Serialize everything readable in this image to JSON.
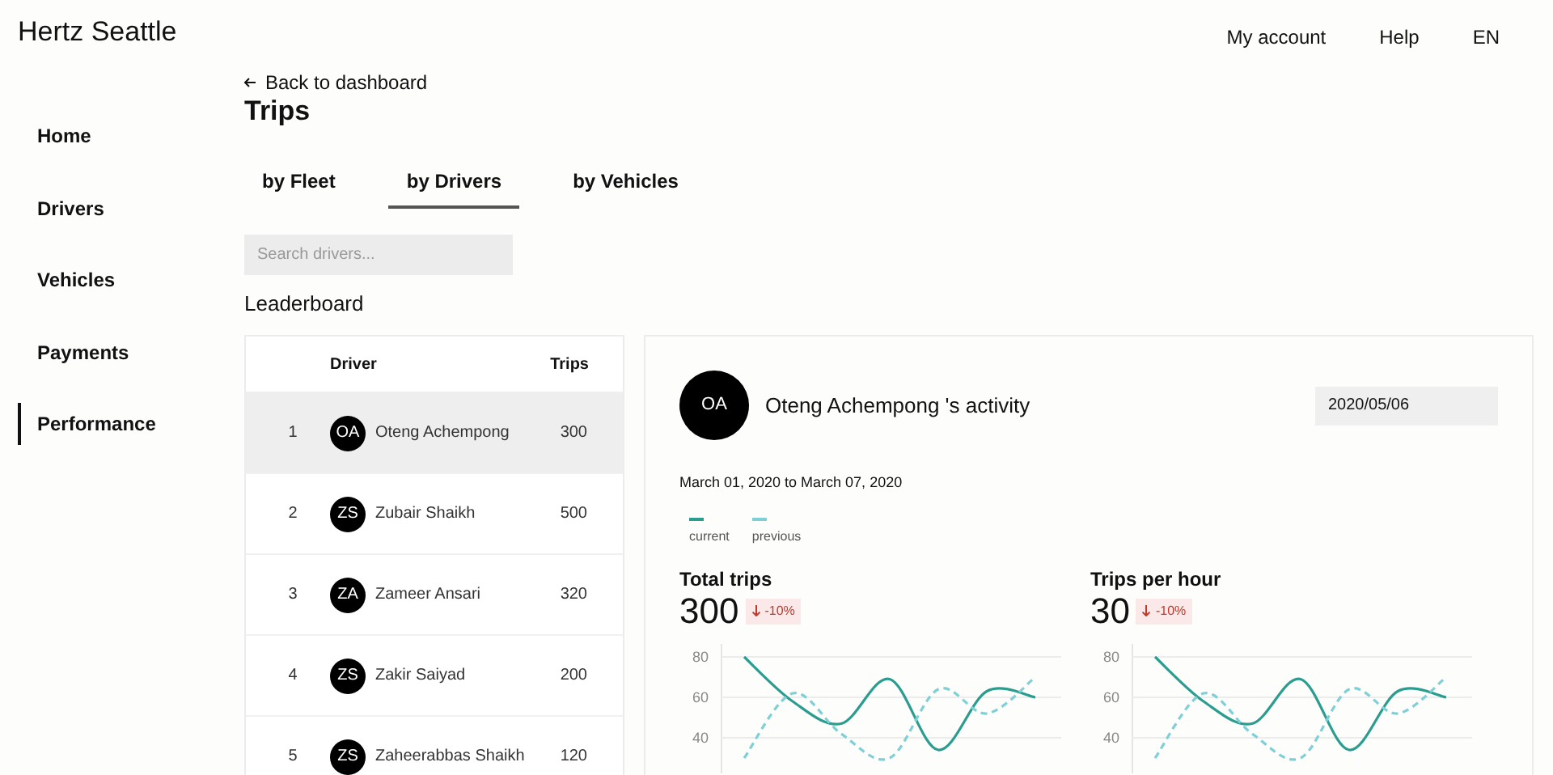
{
  "brand": "Hertz Seattle",
  "top_nav": [
    "My account",
    "Help",
    "EN"
  ],
  "sidebar": {
    "items": [
      {
        "label": "Home",
        "selected": false
      },
      {
        "label": "Drivers",
        "selected": false
      },
      {
        "label": "Vehicles",
        "selected": false
      },
      {
        "label": "Payments",
        "selected": false
      },
      {
        "label": "Performance",
        "selected": true
      }
    ]
  },
  "back_link": "Back to dashboard",
  "page_title": "Trips",
  "tabs": [
    {
      "label": "by Fleet",
      "selected": false
    },
    {
      "label": "by Drivers",
      "selected": true
    },
    {
      "label": "by Vehicles",
      "selected": false
    }
  ],
  "search": {
    "placeholder": "Search drivers..."
  },
  "leaderboard": {
    "title": "Leaderboard",
    "columns": [
      "Driver",
      "Trips"
    ],
    "rows": [
      {
        "rank": "1",
        "initials": "OA",
        "name": "Oteng Achempong",
        "trips": "300",
        "selected": true
      },
      {
        "rank": "2",
        "initials": "ZS",
        "name": "Zubair Shaikh",
        "trips": "500",
        "selected": false
      },
      {
        "rank": "3",
        "initials": "ZA",
        "name": "Zameer Ansari",
        "trips": "320",
        "selected": false
      },
      {
        "rank": "4",
        "initials": "ZS",
        "name": "Zakir Saiyad",
        "trips": "200",
        "selected": false
      },
      {
        "rank": "5",
        "initials": "ZS",
        "name": "Zaheerabbas Shaikh",
        "trips": "120",
        "selected": false
      }
    ]
  },
  "activity": {
    "initials": "OA",
    "title": "Oteng Achempong 's activity",
    "date": "2020/05/06",
    "range": "March 01, 2020 to March 07, 2020",
    "legend": [
      {
        "label": "current",
        "color": "#2a9d8f"
      },
      {
        "label": "previous",
        "color": "#7fcfd6"
      }
    ],
    "metrics": [
      {
        "title": "Total trips",
        "value": "300",
        "change": "-10%",
        "y_ticks": [
          "80",
          "60",
          "40"
        ]
      },
      {
        "title": "Trips per hour",
        "value": "30",
        "change": "-10%",
        "y_ticks": [
          "80",
          "60",
          "40"
        ]
      }
    ]
  }
}
